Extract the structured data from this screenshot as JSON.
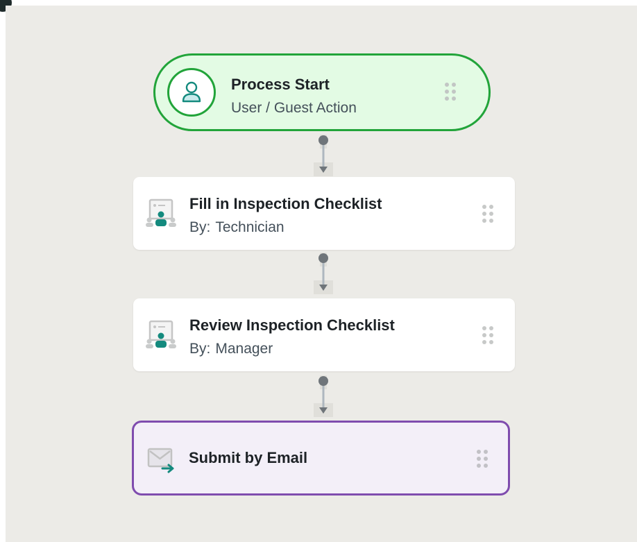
{
  "flow": {
    "start": {
      "title": "Process Start",
      "subtitle": "User / Guest Action",
      "icon": "user-icon",
      "accent": "#22a43a",
      "fill": "#e3fbe4"
    },
    "steps": [
      {
        "title": "Fill in Inspection Checklist",
        "by_label": "By:",
        "assignee": "Technician",
        "icon": "form-user-icon"
      },
      {
        "title": "Review Inspection Checklist",
        "by_label": "By:",
        "assignee": "Manager",
        "icon": "form-user-icon"
      }
    ],
    "end": {
      "title": "Submit by Email",
      "icon": "email-send-icon",
      "accent": "#7f4cae",
      "fill": "#f3eff8"
    },
    "handle_icon": "drag-handle-icon",
    "colors": {
      "canvas": "#ecebe7",
      "teal": "#148a7e",
      "connector": "#6f757a"
    }
  }
}
